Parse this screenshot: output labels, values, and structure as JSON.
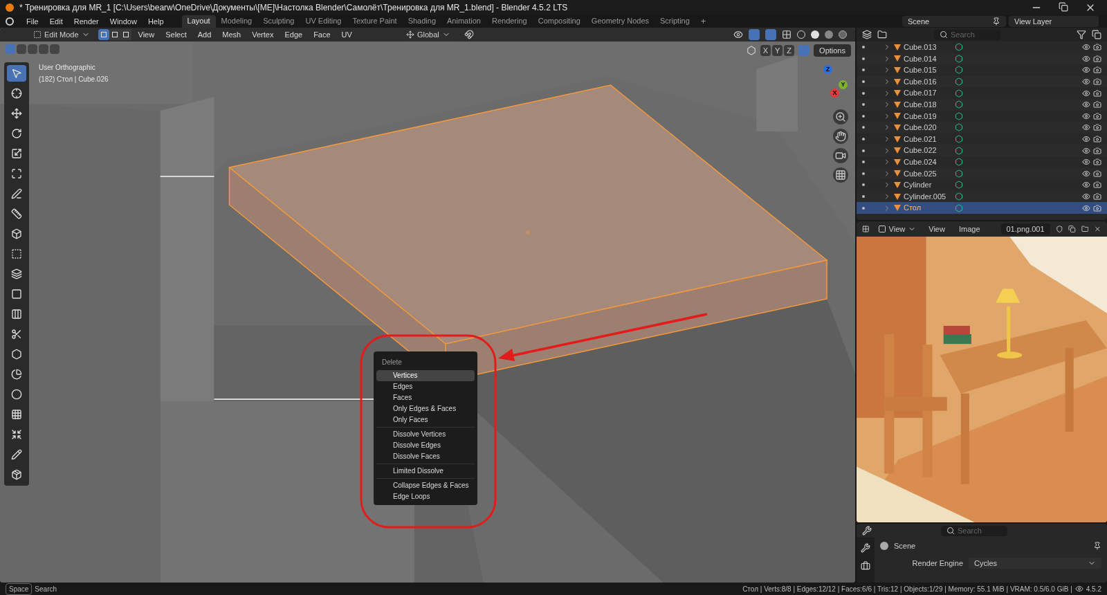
{
  "window": {
    "title": "* Тренировка для MR_1 [C:\\Users\\bearw\\OneDrive\\Документы\\[ME]\\Настолка Blender\\Самолёт\\Тренировка для MR_1.blend] - Blender 4.5.2 LTS"
  },
  "menu": [
    "File",
    "Edit",
    "Render",
    "Window",
    "Help"
  ],
  "workspaces": [
    {
      "label": "Layout",
      "selected": true
    },
    {
      "label": "Modeling",
      "selected": false
    },
    {
      "label": "Sculpting",
      "selected": false
    },
    {
      "label": "UV Editing",
      "selected": false
    },
    {
      "label": "Texture Paint",
      "selected": false
    },
    {
      "label": "Shading",
      "selected": false
    },
    {
      "label": "Animation",
      "selected": false
    },
    {
      "label": "Rendering",
      "selected": false
    },
    {
      "label": "Compositing",
      "selected": false
    },
    {
      "label": "Geometry Nodes",
      "selected": false
    },
    {
      "label": "Scripting",
      "selected": false
    }
  ],
  "add_workspace": "+",
  "scene": {
    "value": "Scene"
  },
  "view_layer": {
    "value": "View Layer"
  },
  "viewport": {
    "mode": "Edit Mode",
    "select_modes": [
      {
        "selected": true
      },
      {
        "selected": false
      },
      {
        "selected": false
      }
    ],
    "menus": [
      "View",
      "Select",
      "Add",
      "Mesh",
      "Vertex",
      "Edge",
      "Face",
      "UV"
    ],
    "orientation": "Global",
    "axes": [
      "X",
      "Y",
      "Z"
    ],
    "options": "Options",
    "info": [
      "User Orthographic",
      "(182) Стол | Cube.026"
    ],
    "gizmo": [
      "Z",
      "Y",
      "X"
    ],
    "tools": [
      {
        "selected": true
      },
      {
        "selected": false
      },
      {
        "selected": false
      },
      {
        "selected": false
      },
      {
        "selected": false
      },
      {
        "selected": false
      },
      {
        "selected": false
      },
      {
        "selected": false
      },
      {
        "selected": false
      },
      {
        "selected": false
      },
      {
        "selected": false
      },
      {
        "selected": false
      },
      {
        "selected": false
      },
      {
        "selected": false
      },
      {
        "selected": false
      },
      {
        "selected": false
      },
      {
        "selected": false
      },
      {
        "selected": false
      },
      {
        "selected": false
      },
      {
        "selected": false
      },
      {
        "selected": false
      }
    ]
  },
  "context_menu": {
    "title": "Delete",
    "groups": [
      [
        {
          "label": "Vertices",
          "selected": true
        },
        {
          "label": "Edges",
          "selected": false
        },
        {
          "label": "Faces",
          "selected": false
        },
        {
          "label": "Only Edges & Faces",
          "selected": false
        },
        {
          "label": "Only Faces",
          "selected": false
        }
      ],
      [
        {
          "label": "Dissolve Vertices",
          "selected": false
        },
        {
          "label": "Dissolve Edges",
          "selected": false
        },
        {
          "label": "Dissolve Faces",
          "selected": false
        }
      ],
      [
        {
          "label": "Limited Dissolve",
          "selected": false
        }
      ],
      [
        {
          "label": "Collapse Edges & Faces",
          "selected": false
        },
        {
          "label": "Edge Loops",
          "selected": false
        }
      ]
    ]
  },
  "outliner": {
    "search": {
      "placeholder": "Search"
    },
    "rows": [
      {
        "name": "Cube.013",
        "selected": false
      },
      {
        "name": "Cube.014",
        "selected": false
      },
      {
        "name": "Cube.015",
        "selected": false
      },
      {
        "name": "Cube.016",
        "selected": false
      },
      {
        "name": "Cube.017",
        "selected": false
      },
      {
        "name": "Cube.018",
        "selected": false
      },
      {
        "name": "Cube.019",
        "selected": false
      },
      {
        "name": "Cube.020",
        "selected": false
      },
      {
        "name": "Cube.021",
        "selected": false
      },
      {
        "name": "Cube.022",
        "selected": false
      },
      {
        "name": "Cube.024",
        "selected": false
      },
      {
        "name": "Cube.025",
        "selected": false
      },
      {
        "name": "Cylinder",
        "selected": false
      },
      {
        "name": "Cylinder.005",
        "selected": false
      },
      {
        "name": "Стол",
        "selected": true
      }
    ]
  },
  "image_editor": {
    "view_mode": "View",
    "menus": [
      "View",
      "Image"
    ],
    "image": "01.png.001"
  },
  "properties": {
    "search": {
      "placeholder": "Search"
    },
    "context": "Scene",
    "fields": [
      {
        "label": "Render Engine",
        "value": "Cycles"
      }
    ]
  },
  "status_bar": {
    "key": "Space",
    "action": "Search",
    "stats": "Стол | Verts:8/8 | Edges:12/12 | Faces:6/6 | Tris:12 | Objects:1/29 | Memory: 55.1 MiB | VRAM: 0.5/6.0 GiB |",
    "version": "4.5.2"
  }
}
